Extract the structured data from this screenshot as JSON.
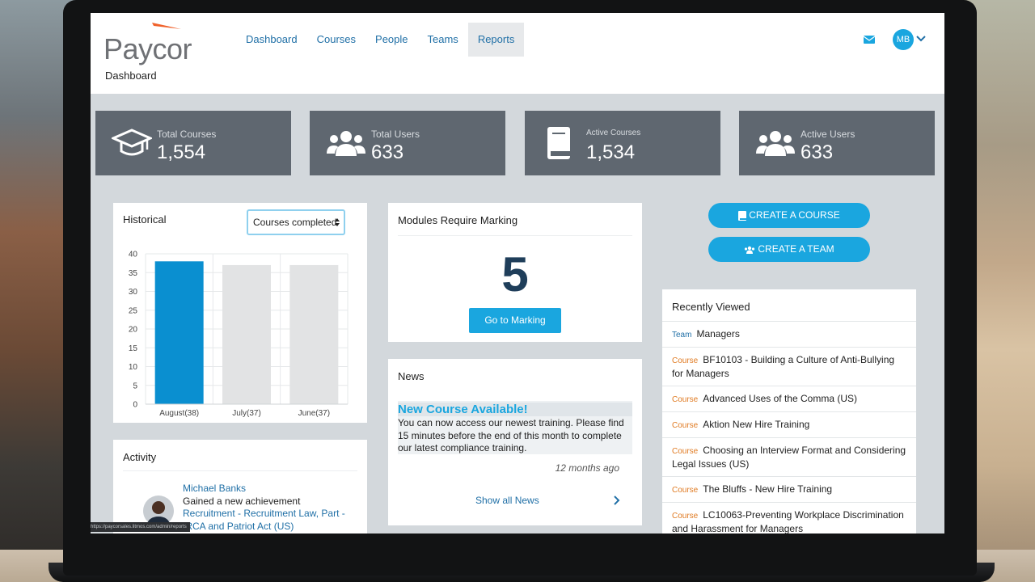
{
  "header": {
    "logo_text": "Paycor",
    "nav": [
      "Dashboard",
      "Courses",
      "People",
      "Teams",
      "Reports"
    ],
    "active_nav_index": 4,
    "user_initials": "MB",
    "page_title": "Dashboard"
  },
  "stats": [
    {
      "label": "Total Courses",
      "value": "1,554",
      "icon": "graduation-cap-icon"
    },
    {
      "label": "Total Users",
      "value": "633",
      "icon": "users-icon"
    },
    {
      "label": "Active Courses",
      "value": "1,534",
      "icon": "book-icon"
    },
    {
      "label": "Active Users",
      "value": "633",
      "icon": "users-icon"
    }
  ],
  "historical": {
    "title": "Historical",
    "select_value": "Courses completed"
  },
  "chart_data": {
    "type": "bar",
    "categories": [
      "August(38)",
      "July(37)",
      "June(37)"
    ],
    "values": [
      38,
      37,
      37
    ],
    "ylim": [
      0,
      40
    ],
    "yticks": [
      0,
      5,
      10,
      15,
      20,
      25,
      30,
      35,
      40
    ],
    "grid": true,
    "colors": {
      "highlight": "#0a8fd0",
      "other": "#e2e3e4"
    }
  },
  "marking": {
    "title": "Modules Require Marking",
    "count": "5",
    "button": "Go to Marking"
  },
  "news": {
    "title": "News",
    "headline": "New Course Available!",
    "body": "You can now access our newest training. Please find 15 minutes before the end of this month to complete our latest compliance training.",
    "time": "12 months ago",
    "show_all": "Show all News"
  },
  "actions": {
    "create_course": "CREATE A COURSE",
    "create_team": "CREATE A TEAM"
  },
  "recently_viewed": {
    "title": "Recently Viewed",
    "items": [
      {
        "type": "Team",
        "name": "Managers"
      },
      {
        "type": "Course",
        "name": "BF10103 - Building a Culture of Anti-Bullying for Managers"
      },
      {
        "type": "Course",
        "name": "Advanced Uses of the Comma (US)"
      },
      {
        "type": "Course",
        "name": "Aktion New Hire Training"
      },
      {
        "type": "Course",
        "name": "Choosing an Interview Format and Considering Legal Issues (US)"
      },
      {
        "type": "Course",
        "name": "The Bluffs - New Hire Training"
      },
      {
        "type": "Course",
        "name": "LC10063-Preventing Workplace Discrimination and Harassment for Managers"
      }
    ]
  },
  "activity": {
    "title": "Activity",
    "user": "Michael Banks",
    "action": "Gained a new achievement",
    "link": "Recruitment - Recruitment Law, Part - IRCA and Patriot Act (US)"
  },
  "status_url": "https://paycorsales.litmos.com/admin/reports",
  "colors": {
    "accent": "#1aa6df",
    "nav_link": "#1f6fa6",
    "stat_bg": "#5f6770"
  }
}
